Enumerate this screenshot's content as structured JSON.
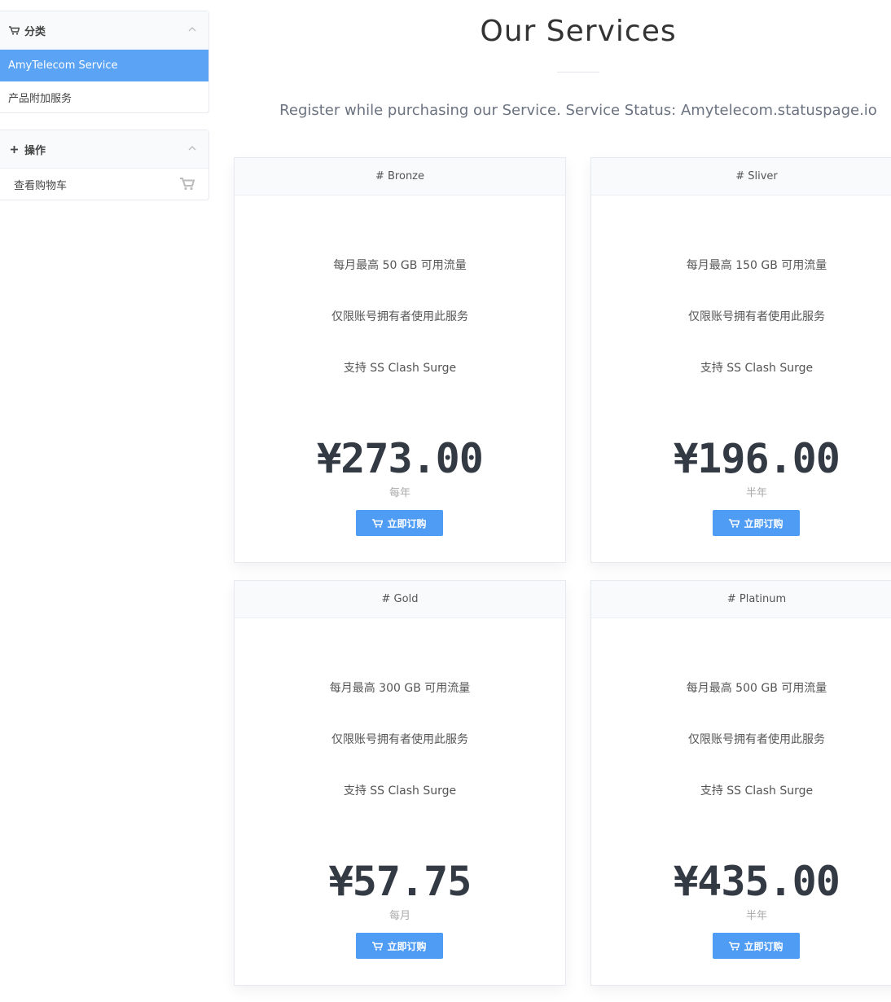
{
  "sidebar": {
    "categories": {
      "title": "分类",
      "items": [
        {
          "label": "AmyTelecom Service",
          "active": true
        },
        {
          "label": "产品附加服务",
          "active": false
        }
      ]
    },
    "actions": {
      "title": "操作",
      "items": [
        {
          "label": "查看购物车"
        }
      ]
    }
  },
  "header": {
    "title": "Our Services",
    "subtitle": "Register while purchasing our Service. Service Status: Amytelecom.statuspage.io"
  },
  "plans": [
    {
      "name": "# Bronze",
      "features": [
        "每月最高 50 GB 可用流量",
        "仅限账号拥有者使用此服务",
        "支持 SS Clash Surge"
      ],
      "price": "¥273.00",
      "period": "每年",
      "button": "立即订购"
    },
    {
      "name": "# Sliver",
      "features": [
        "每月最高 150 GB 可用流量",
        "仅限账号拥有者使用此服务",
        "支持 SS Clash Surge"
      ],
      "price": "¥196.00",
      "period": "半年",
      "button": "立即订购"
    },
    {
      "name": "# Gold",
      "features": [
        "每月最高 300 GB 可用流量",
        "仅限账号拥有者使用此服务",
        "支持 SS Clash Surge"
      ],
      "price": "¥57.75",
      "period": "每月",
      "button": "立即订购"
    },
    {
      "name": "# Platinum",
      "features": [
        "每月最高 500 GB 可用流量",
        "仅限账号拥有者使用此服务",
        "支持 SS Clash Surge"
      ],
      "price": "¥435.00",
      "period": "半年",
      "button": "立即订购"
    }
  ],
  "colors": {
    "accent": "#5aa3f5",
    "button": "#4f9cf5",
    "price": "#333a44"
  }
}
